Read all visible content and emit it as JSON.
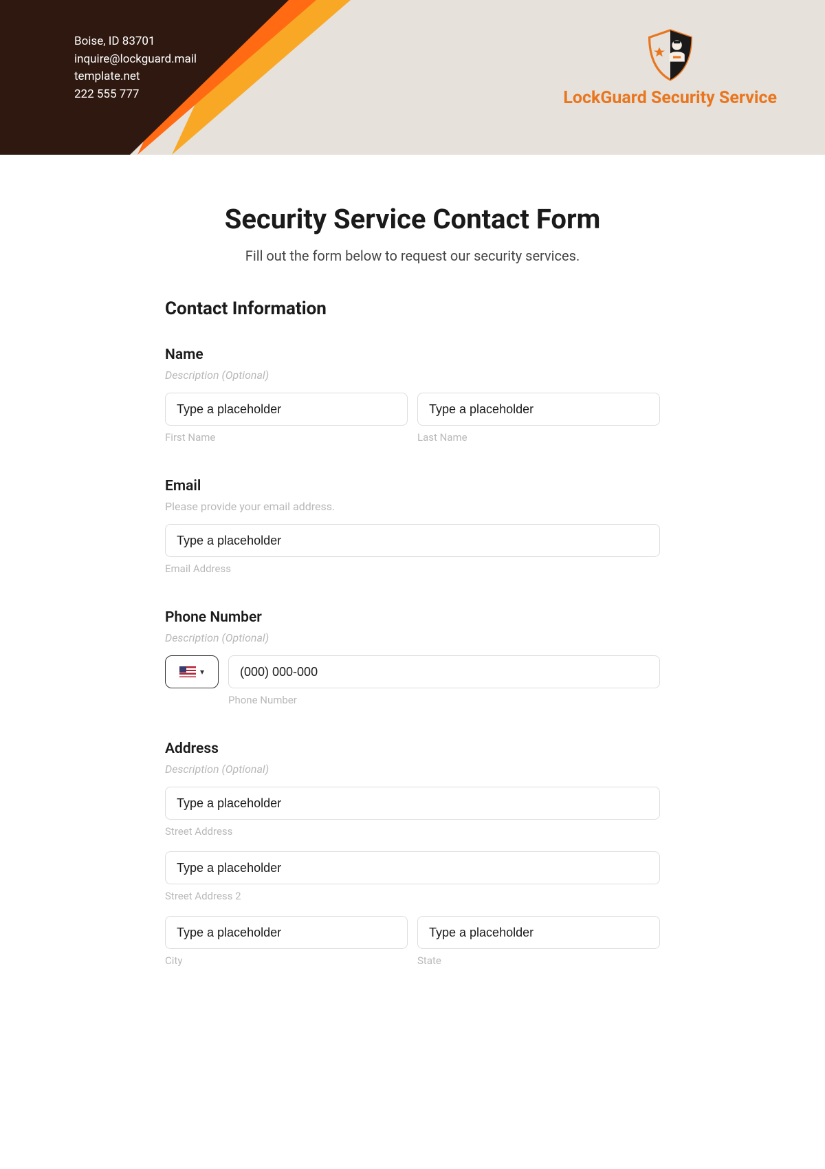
{
  "header": {
    "contact_line1": "Boise, ID 83701",
    "contact_line2": "inquire@lockguard.mail",
    "contact_line3": "template.net",
    "contact_line4": "222 555 777",
    "company_name": "LockGuard Security Service"
  },
  "form": {
    "title": "Security Service Contact Form",
    "subtitle": "Fill out the form below to request our security services.",
    "section_heading": "Contact Information"
  },
  "name": {
    "label": "Name",
    "description": "Description (Optional)",
    "first_placeholder": "Type a placeholder",
    "last_placeholder": "Type a placeholder",
    "first_sublabel": "First Name",
    "last_sublabel": "Last Name"
  },
  "email": {
    "label": "Email",
    "description": "Please provide your email address.",
    "placeholder": "Type a placeholder",
    "sublabel": "Email Address"
  },
  "phone": {
    "label": "Phone Number",
    "description": "Description (Optional)",
    "placeholder": "(000) 000-000",
    "sublabel": "Phone Number"
  },
  "address": {
    "label": "Address",
    "description": "Description (Optional)",
    "street1_placeholder": "Type a placeholder",
    "street1_sublabel": "Street Address",
    "street2_placeholder": "Type a placeholder",
    "street2_sublabel": "Street Address 2",
    "city_placeholder": "Type a placeholder",
    "city_sublabel": "City",
    "state_placeholder": "Type a placeholder",
    "state_sublabel": "State"
  }
}
